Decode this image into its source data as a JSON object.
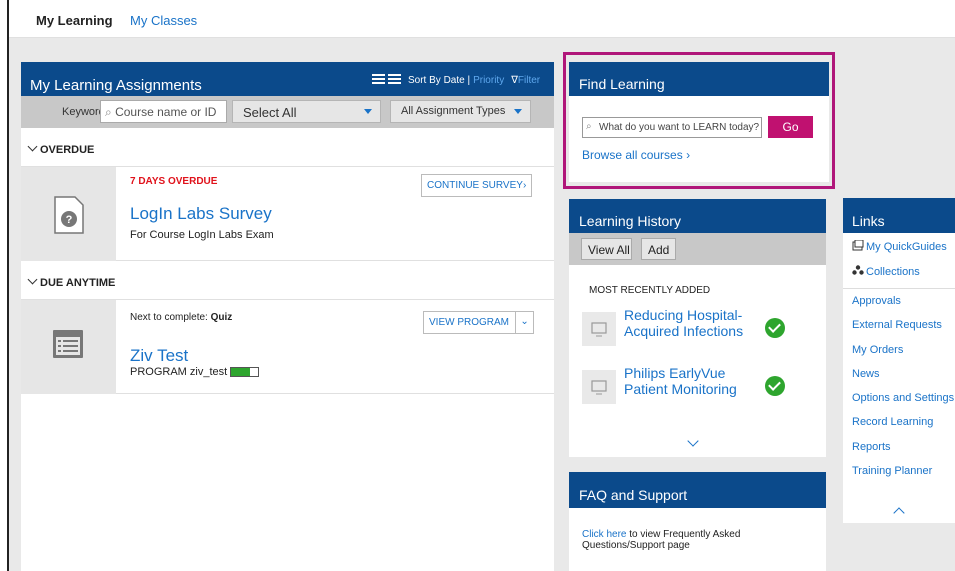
{
  "nav": {
    "tabs": [
      "My Learning",
      "My Classes"
    ]
  },
  "assignments": {
    "title": "My Learning Assignments",
    "sort_label": "Sort By Date |",
    "priority_label": "Priority",
    "filter_label": "Filter",
    "keyword_label": "Keyword",
    "keyword_placeholder": "Course name or ID",
    "select_all": "Select All",
    "assignment_types": "All Assignment Types",
    "sections": {
      "overdue": {
        "label": "OVERDUE",
        "item": {
          "status": "7 DAYS OVERDUE",
          "title": "LogIn Labs Survey",
          "subtitle": "For Course LogIn Labs Exam",
          "button": "CONTINUE SURVEY"
        }
      },
      "due_anytime": {
        "label": "DUE ANYTIME",
        "item": {
          "next_prefix": "Next to complete:",
          "next_value": "Quiz",
          "title": "Ziv Test",
          "program": "PROGRAM ziv_test",
          "progress": 0.7,
          "button": "VIEW PROGRAM"
        }
      }
    }
  },
  "find": {
    "title": "Find Learning",
    "search_placeholder": "What do you want to LEARN today?",
    "go": "Go",
    "browse": "Browse all courses"
  },
  "history": {
    "title": "Learning History",
    "view_all": "View All",
    "add": "Add",
    "recent_label": "MOST RECENTLY ADDED",
    "items": [
      {
        "title": "Reducing Hospital-Acquired Infections"
      },
      {
        "title": "Philips EarlyVue Patient Monitoring"
      }
    ]
  },
  "faq": {
    "title": "FAQ and Support",
    "link": "Click here",
    "text": "to view Frequently Asked Questions/Support page"
  },
  "links": {
    "title": "Links",
    "quickguides": "My QuickGuides",
    "collections": "Collections",
    "items": [
      "Approvals",
      "External Requests",
      "My Orders",
      "News",
      "Options and Settings",
      "Record Learning",
      "Reports",
      "Training Planner"
    ]
  },
  "colors": {
    "header": "#0b4a8b",
    "link": "#1a73c8",
    "go_button": "#c01170",
    "highlight_border": "#b0177a",
    "overdue": "#e0121b",
    "success": "#2ea52e"
  }
}
